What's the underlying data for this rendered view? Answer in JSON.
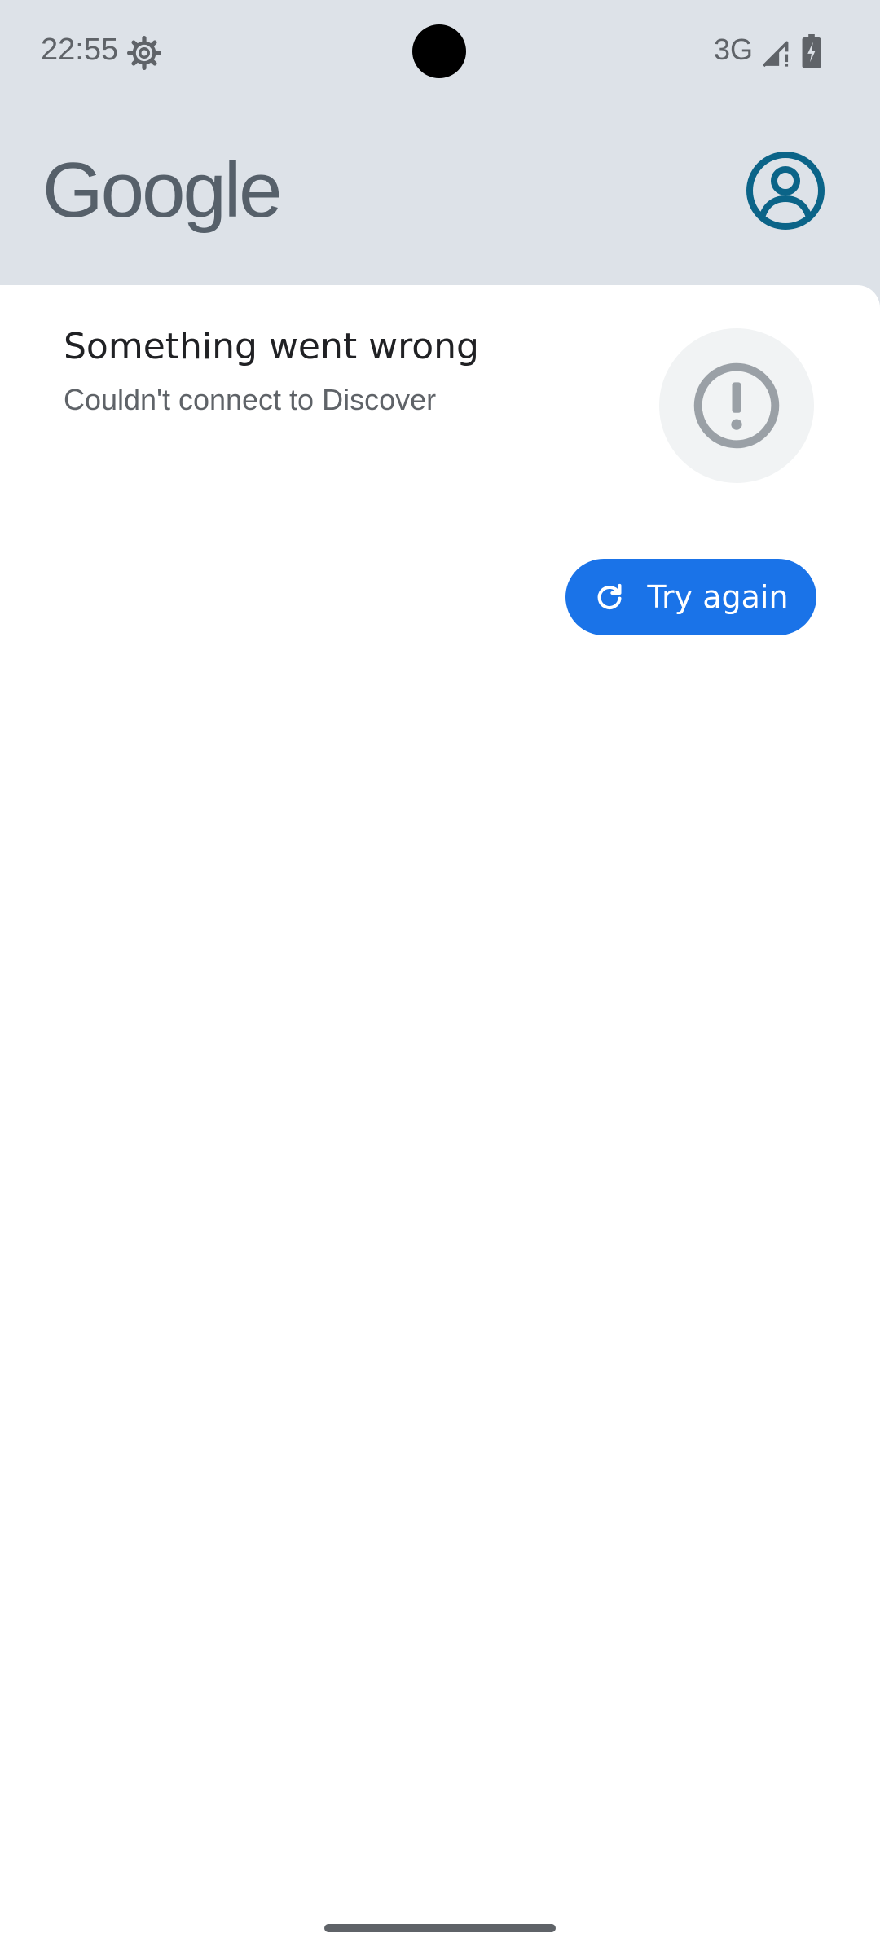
{
  "status_bar": {
    "time": "22:55",
    "network": "3G",
    "icons": [
      "settings-gear-icon",
      "camera-cutout",
      "signal-icon",
      "battery-charging-icon"
    ]
  },
  "header": {
    "logo_text": "Google",
    "account_icon": "account-circle-icon"
  },
  "error_card": {
    "title": "Something went wrong",
    "subtitle": "Couldn't connect to Discover",
    "illustration_icon": "alert-circle-icon",
    "retry_icon": "refresh-icon",
    "retry_label": "Try again"
  },
  "colors": {
    "header_bg": "#dde2e8",
    "content_bg": "#ffffff",
    "accent": "#1a73e8",
    "account_icon": "#0b6488",
    "title_text": "#202124",
    "secondary_text": "#5f6368"
  }
}
